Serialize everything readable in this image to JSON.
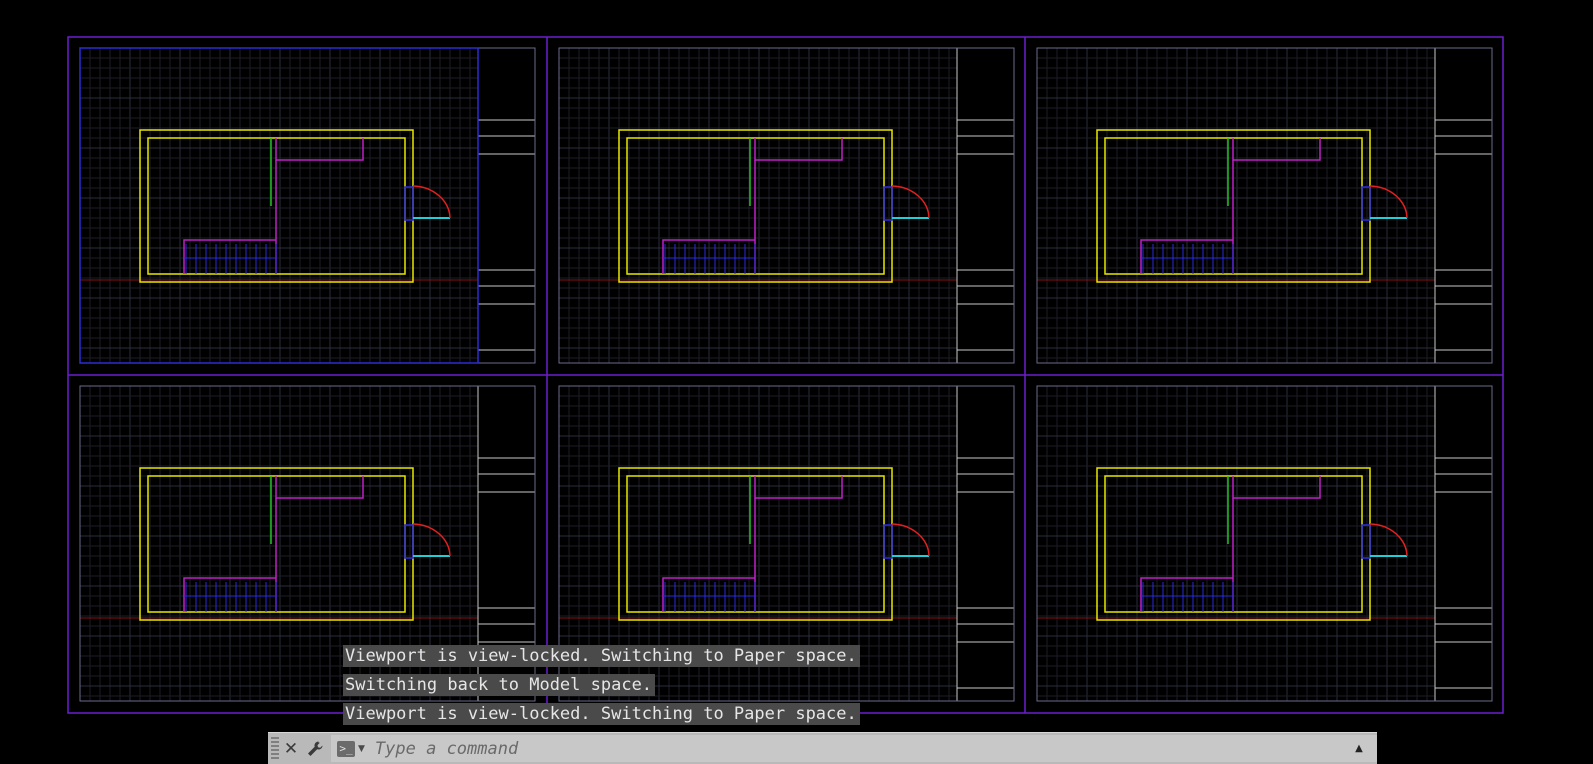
{
  "app": "CAD layout view",
  "colors": {
    "background": "#000000",
    "grid_minor": "#1b1d26",
    "grid_major": "#2b2e3c",
    "layout_frame": "#6a1fd0",
    "active_viewport": "#2c2cd6",
    "viewport_border": "#6a6a8a",
    "wall": "#e8e800",
    "partition_green": "#22c022",
    "magenta": "#c020c8",
    "stair_blue": "#2a2ae0",
    "door_arc": "#e02020",
    "door_cyan": "#20d0d8",
    "axis_red": "#8a1010",
    "title_block": "#c8c8c8"
  },
  "viewports": [
    {
      "id": "viewport-1",
      "active": true
    },
    {
      "id": "viewport-2",
      "active": false
    },
    {
      "id": "viewport-3",
      "active": false
    },
    {
      "id": "viewport-4",
      "active": false
    },
    {
      "id": "viewport-5",
      "active": false
    },
    {
      "id": "viewport-6",
      "active": false
    }
  ],
  "command_history": [
    "Viewport is view-locked. Switching to Paper space.",
    "Switching back to Model space.",
    "Viewport is view-locked. Switching to Paper space."
  ],
  "command_line": {
    "placeholder": "Type a command",
    "close_icon": "close-icon",
    "customize_icon": "wrench-icon",
    "prompt_icon": "command-prompt-icon",
    "history_toggle_icon": "triangle-up-icon"
  }
}
